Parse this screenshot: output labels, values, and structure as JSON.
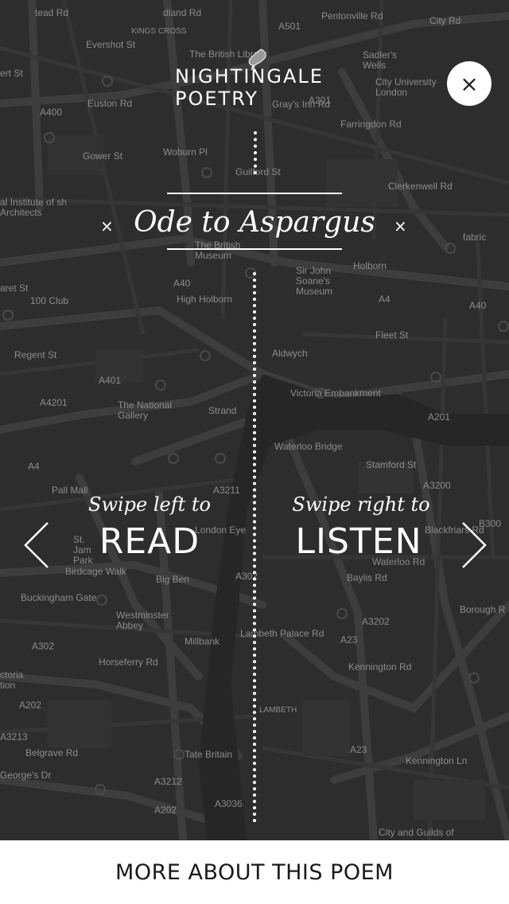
{
  "app": {
    "logo_line1": "NIGHTINGALE",
    "logo_line2": "POETRY",
    "close_icon": "×",
    "poem_title": "Ode to Aspargus",
    "title_marker": "×"
  },
  "actions": {
    "left_sub": "Swipe left to",
    "left_main": "READ",
    "right_sub": "Swipe right to",
    "right_main": "LISTEN",
    "bottom_button": "MORE ABOUT THIS POEM"
  },
  "map": {
    "labels": [
      "Pentonville Rd",
      "City Rd",
      "KINGS CROSS",
      "dland Rd",
      "Evershot St",
      "tead Rd",
      "The British Library",
      "Sadler's Wells",
      "City University London",
      "ert St",
      "A400",
      "Euston Rd",
      "A501",
      "A201",
      "Farringdon Rd",
      "Gower St",
      "Woburn Pl",
      "Gray's Inn Rd",
      "Guilford St",
      "Clerkenwell Rd",
      "al Institute of sh Architects",
      "fabric",
      "The British Museum",
      "Holborn",
      "A40",
      "aret St",
      "High Holborn",
      "Sir John Soane's Museum",
      "100 Club",
      "A4",
      "A40",
      "Fleet St",
      "Aldwych",
      "Regent St",
      "A4201",
      "A401",
      "The National Gallery",
      "Strand",
      "Victoria Embankment",
      "Waterloo Bridge",
      "A201",
      "Stamford St",
      "A4",
      "Pall Mall",
      "A3211",
      "A3200",
      "St. Jam Park",
      "London Eye",
      "Blackfriars Rd",
      "B300",
      "Birdcage Walk",
      "Big Ben",
      "A302",
      "Waterloo Rd",
      "Westminster Abbey",
      "Baylis Rd",
      "A3202",
      "Borough R",
      "Buckingham Gate",
      "A302",
      "Horseferry Rd",
      "Millbank",
      "Lambeth Palace Rd",
      "A23",
      "Kennington Rd",
      "ctoria tion",
      "A202",
      "LAMBETH",
      "A3213",
      "Belgrave Rd",
      "Tate Britain",
      "A3212",
      "A23",
      "Kennington Ln",
      "George's Dr",
      "A202",
      "A3036",
      "City and Guilds of"
    ]
  }
}
